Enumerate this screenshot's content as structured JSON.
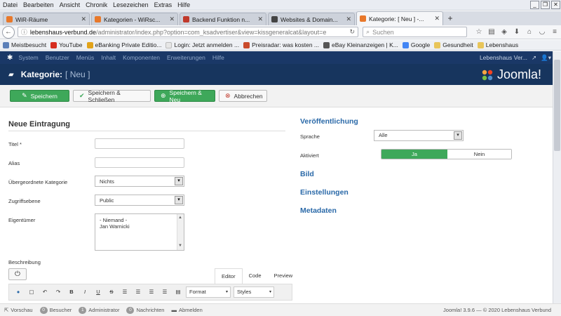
{
  "browser": {
    "menu": [
      "Datei",
      "Bearbeiten",
      "Ansicht",
      "Chronik",
      "Lesezeichen",
      "Extras",
      "Hilfe"
    ],
    "window_controls": [
      "_",
      "❐",
      "✕"
    ],
    "tabs": [
      {
        "label": "WiR-Räume",
        "icon": "joomla-icon",
        "color": "#e8782a"
      },
      {
        "label": "Kategorien - WiRsc...",
        "icon": "joomla-icon",
        "color": "#e8782a"
      },
      {
        "label": "Backend Funktion n...",
        "icon": "page-icon",
        "color": "#c0392b"
      },
      {
        "label": "Websites & Domain...",
        "icon": "page-icon",
        "color": "#444444"
      },
      {
        "label": "Kategorie: [ Neu ] -...",
        "icon": "joomla-icon",
        "color": "#e8782a",
        "active": true
      }
    ],
    "url_host": "lebenshaus-verbund.de",
    "url_path": "/administrator/index.php?option=com_ksadvertiser&view=kissgeneralcat&layout=e",
    "search_placeholder": "Suchen",
    "bookmarks": [
      {
        "label": "Meistbesucht",
        "color": "#5b7fb8"
      },
      {
        "label": "YouTube",
        "color": "#d62d20"
      },
      {
        "label": "eBanking Private Editio...",
        "color": "#e2a31a"
      },
      {
        "label": "Login: Jetzt anmelden ...",
        "color": "#e6e6e6"
      },
      {
        "label": "Preisradar: was kosten ...",
        "color": "#c94a2c"
      },
      {
        "label": "eBay Kleinanzeigen | K...",
        "color": "#555555"
      },
      {
        "label": "Google",
        "color": "#4285f4"
      },
      {
        "label": "Gesundheit",
        "color": "#e8c55a"
      },
      {
        "label": "Lebenshaus",
        "color": "#e8c55a"
      }
    ]
  },
  "joomla": {
    "topmenu": [
      "System",
      "Benutzer",
      "Menüs",
      "Inhalt",
      "Komponenten",
      "Erweiterungen",
      "Hilfe"
    ],
    "site_name": "Lebenshaus Ver...",
    "header_title": "Kategorie:",
    "header_sub": "[ Neu ]",
    "brand": "Joomla!",
    "toolbar": {
      "save": "Speichern",
      "save_close": "Speichern & Schließen",
      "save_new": "Speichern & Neu",
      "cancel": "Abbrechen"
    },
    "form": {
      "section_title": "Neue Eintragung",
      "title_label": "Titel *",
      "alias_label": "Alias",
      "parent_label": "Übergeordnete Kategorie",
      "parent_value": "Nichts",
      "access_label": "Zugriffsebene",
      "access_value": "Public",
      "owner_label": "Eigentümer",
      "owner_options": [
        "- Niemand -",
        "Jan Warnicki"
      ],
      "description_label": "Beschreibung",
      "editor_tabs": [
        "Editor",
        "Code",
        "Preview"
      ],
      "format_label": "Format",
      "styles_label": "Styles"
    },
    "publishing": {
      "title": "Veröffentlichung",
      "language_label": "Sprache",
      "language_value": "Alle",
      "active_label": "Aktiviert",
      "yes": "Ja",
      "no": "Nein",
      "active_value": true
    },
    "sections": [
      "Bild",
      "Einstellungen",
      "Metadaten"
    ],
    "status": {
      "preview": "Vorschau",
      "visitors_count": "0",
      "visitors": "Besucher",
      "admins_count": "1",
      "admins": "Administrator",
      "messages_count": "0",
      "messages": "Nachrichten",
      "logout": "Abmelden",
      "version": "Joomla! 3.9.6 — © 2020 Lebenshaus Verbund"
    }
  }
}
